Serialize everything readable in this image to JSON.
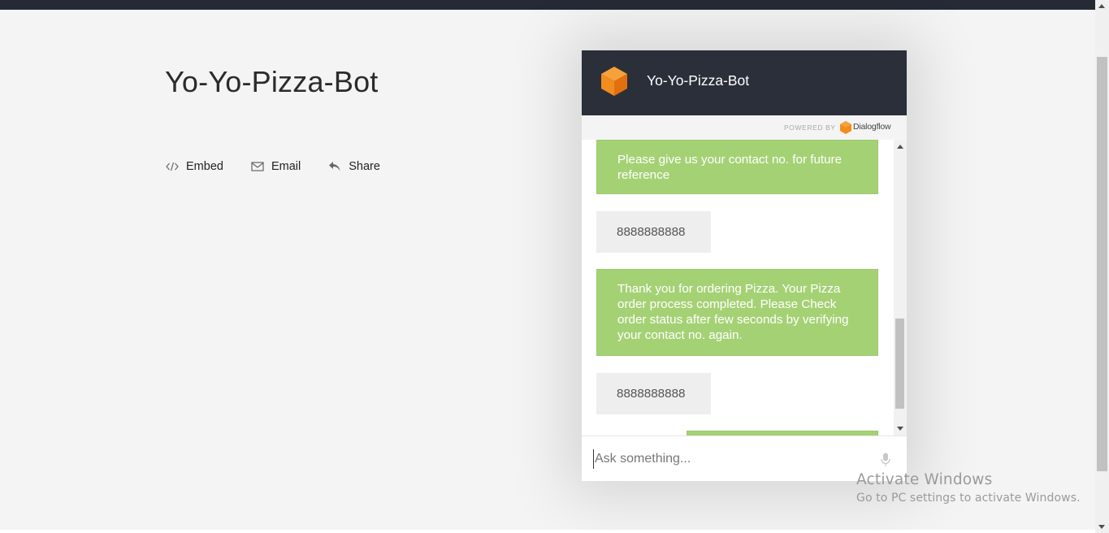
{
  "page": {
    "title": "Yo-Yo-Pizza-Bot",
    "actions": [
      {
        "label": "Embed",
        "icon": "code-icon"
      },
      {
        "label": "Email",
        "icon": "envelope-icon"
      },
      {
        "label": "Share",
        "icon": "reply-arrow-icon"
      }
    ]
  },
  "widget": {
    "title": "Yo-Yo-Pizza-Bot",
    "powered_by": "POWERED BY",
    "provider": "Dialogflow",
    "messages": [
      {
        "from": "bot",
        "text": "Please give us your contact no. for future reference"
      },
      {
        "from": "user",
        "text": "8888888888"
      },
      {
        "from": "bot",
        "text": "Thank you for ordering Pizza. Your Pizza order process completed. Please Check order status after few seconds by verifying your contact no. again."
      },
      {
        "from": "user",
        "text": "8888888888"
      },
      {
        "from": "bot",
        "text": ""
      }
    ],
    "input_placeholder": "Ask something...",
    "colors": {
      "header": "#2b2f3a",
      "bot_bubble": "#a5d175",
      "user_bubble": "#eeeeee",
      "logo": "#f28c1e"
    }
  },
  "os_overlay": {
    "line1": "Activate Windows",
    "line2": "Go to PC settings to activate Windows."
  }
}
